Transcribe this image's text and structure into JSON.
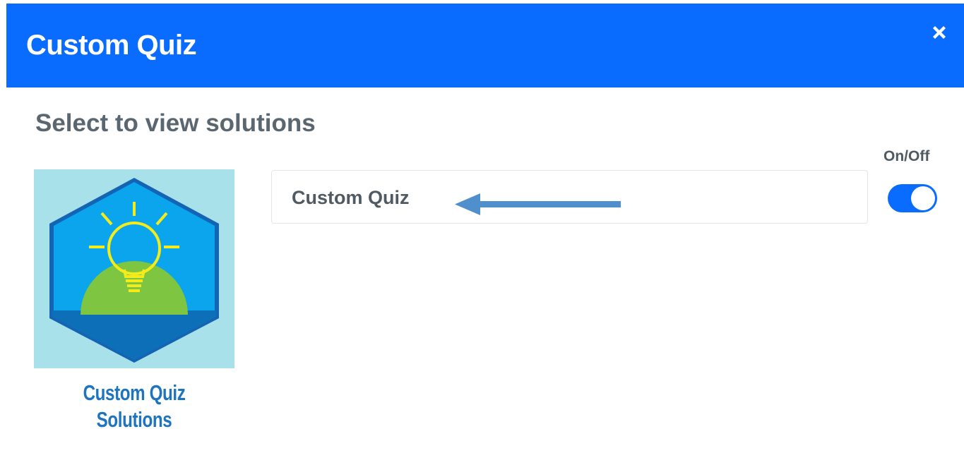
{
  "modal": {
    "title": "Custom Quiz",
    "close_icon": "close-icon",
    "header_color": "#0a6cff"
  },
  "content": {
    "subtitle": "Select to view solutions",
    "badge": {
      "caption_line1": "Custom Quiz",
      "caption_line2": "Solutions",
      "icon": "lightbulb-hexagon-icon"
    },
    "item": {
      "label": "Custom Quiz",
      "annotation": "arrow-left-icon"
    },
    "toggle": {
      "header": "On/Off",
      "state": "on",
      "accent": "#0a6cff"
    }
  }
}
